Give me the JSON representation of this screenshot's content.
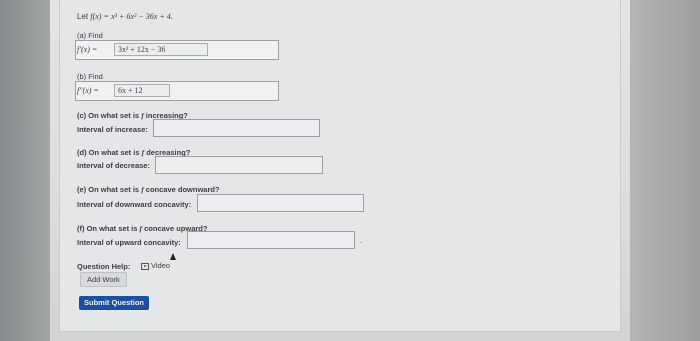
{
  "problem": {
    "intro": "Let",
    "function_lhs": "f(x) =",
    "function_rhs": "x³ + 6x² − 36x + 4."
  },
  "part_a": {
    "label": "(a) Find",
    "lhs": "f′(x) =",
    "answer": "3x² + 12x − 36"
  },
  "part_b": {
    "label": "(b) Find",
    "lhs": "f″(x) =",
    "answer": "6x + 12"
  },
  "part_c": {
    "question_prefix": "(c) On what set is",
    "question_f": "f",
    "question_suffix": "increasing?",
    "field_label": "Interval of increase:",
    "value": ""
  },
  "part_d": {
    "question_prefix": "(d) On what set is",
    "question_f": "f",
    "question_suffix": "decreasing?",
    "field_label": "Interval of decrease:",
    "value": ""
  },
  "part_e": {
    "question_prefix": "(e) On what set is",
    "question_f": "f",
    "question_suffix": "concave downward?",
    "field_label": "Interval of downward concavity:",
    "value": ""
  },
  "part_f": {
    "question_prefix": "(f) On what set is",
    "question_f": "f",
    "question_suffix": "concave upward?",
    "field_label": "Interval of upward concavity:",
    "value": "",
    "trailing": "."
  },
  "help": {
    "label": "Question Help:",
    "video": "Video",
    "add_work": "Add Work"
  },
  "submit": {
    "label": "Submit Question"
  }
}
